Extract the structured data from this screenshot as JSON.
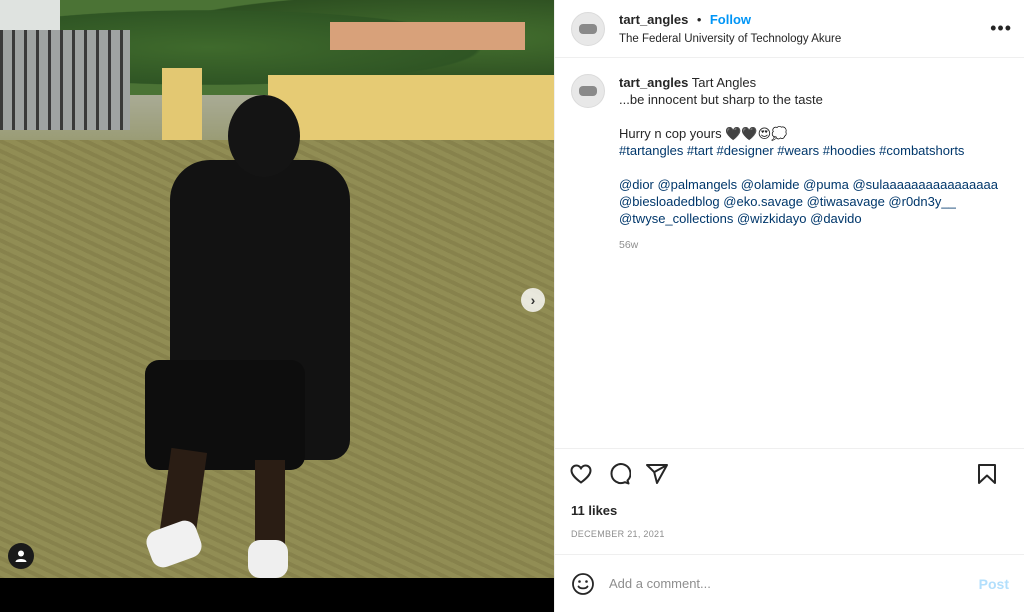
{
  "post": {
    "username": "tart_angles",
    "follow_label": "Follow",
    "separator": "•",
    "location": "The Federal University of Technology Akure",
    "more_label": "•••"
  },
  "caption": {
    "username": "tart_angles",
    "line1_rest": "Tart Angles",
    "line2": "...be innocent but sharp to the taste",
    "line3": "Hurry n cop yours 🖤🖤😍💭",
    "hashtags": "#tartangles #tart #designer #wears #hoodies #combatshorts",
    "mentions1": "@dior @palmangels @olamide @puma @sulaaaaaaaaaaaaaaaa",
    "mentions2": "@biesloadedblog @eko.savage @tiwasavage @r0dn3y__",
    "mentions3": "@twyse_collections @wizkidayo @davido",
    "time_ago": "56w"
  },
  "actions": {
    "likes": "11 likes",
    "date": "DECEMBER 21, 2021",
    "icons": [
      "heart-icon",
      "comment-icon",
      "share-icon",
      "bookmark-icon"
    ]
  },
  "comment": {
    "placeholder": "Add a comment...",
    "post_label": "Post",
    "emoji_icon": "emoji-icon"
  },
  "photo": {
    "next_icon": "chevron-right-icon",
    "tag_icon": "user-tag-icon",
    "next_glyph": "›"
  },
  "colors": {
    "link": "#00376b",
    "follow": "#0095f6",
    "post_disabled": "#b2dffc",
    "muted": "#8e8e8e"
  }
}
